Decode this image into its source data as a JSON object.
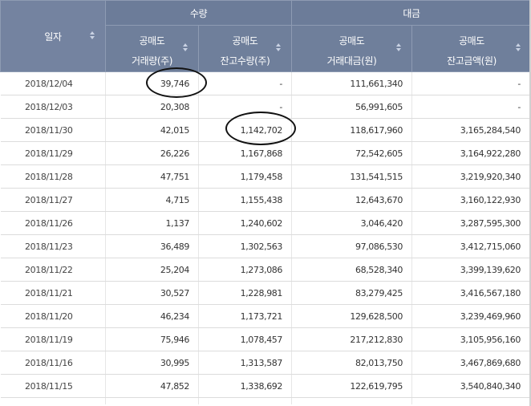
{
  "header": {
    "date_col": "일자",
    "group_qty": "수량",
    "group_amt": "대금",
    "columns": [
      {
        "line1": "공매도",
        "line2": "거래량(주)"
      },
      {
        "line1": "공매도",
        "line2": "잔고수량(주)"
      },
      {
        "line1": "공매도",
        "line2": "거래대금(원)"
      },
      {
        "line1": "공매도",
        "line2": "잔고금액(원)"
      }
    ]
  },
  "rows": [
    {
      "date": "2018/12/04",
      "vol": "39,746",
      "bal_qty": "-",
      "amount": "111,661,340",
      "bal_amt": "-"
    },
    {
      "date": "2018/12/03",
      "vol": "20,308",
      "bal_qty": "-",
      "amount": "56,991,605",
      "bal_amt": "-"
    },
    {
      "date": "2018/11/30",
      "vol": "42,015",
      "bal_qty": "1,142,702",
      "amount": "118,617,960",
      "bal_amt": "3,165,284,540"
    },
    {
      "date": "2018/11/29",
      "vol": "26,226",
      "bal_qty": "1,167,868",
      "amount": "72,542,605",
      "bal_amt": "3,164,922,280"
    },
    {
      "date": "2018/11/28",
      "vol": "47,751",
      "bal_qty": "1,179,458",
      "amount": "131,541,515",
      "bal_amt": "3,219,920,340"
    },
    {
      "date": "2018/11/27",
      "vol": "4,715",
      "bal_qty": "1,155,438",
      "amount": "12,643,670",
      "bal_amt": "3,160,122,930"
    },
    {
      "date": "2018/11/26",
      "vol": "1,137",
      "bal_qty": "1,240,602",
      "amount": "3,046,420",
      "bal_amt": "3,287,595,300"
    },
    {
      "date": "2018/11/23",
      "vol": "36,489",
      "bal_qty": "1,302,563",
      "amount": "97,086,530",
      "bal_amt": "3,412,715,060"
    },
    {
      "date": "2018/11/22",
      "vol": "25,204",
      "bal_qty": "1,273,086",
      "amount": "68,528,340",
      "bal_amt": "3,399,139,620"
    },
    {
      "date": "2018/11/21",
      "vol": "30,527",
      "bal_qty": "1,228,981",
      "amount": "83,279,425",
      "bal_amt": "3,416,567,180"
    },
    {
      "date": "2018/11/20",
      "vol": "46,234",
      "bal_qty": "1,173,721",
      "amount": "129,628,500",
      "bal_amt": "3,239,469,960"
    },
    {
      "date": "2018/11/19",
      "vol": "75,946",
      "bal_qty": "1,078,457",
      "amount": "217,212,830",
      "bal_amt": "3,105,956,160"
    },
    {
      "date": "2018/11/16",
      "vol": "30,995",
      "bal_qty": "1,313,587",
      "amount": "82,013,750",
      "bal_amt": "3,467,869,680"
    },
    {
      "date": "2018/11/15",
      "vol": "47,852",
      "bal_qty": "1,338,692",
      "amount": "122,619,795",
      "bal_amt": "3,540,840,340"
    }
  ],
  "colors": {
    "header_bg": "#6f7f9b",
    "header_text": "#ffffff",
    "annotation": "#111111"
  }
}
